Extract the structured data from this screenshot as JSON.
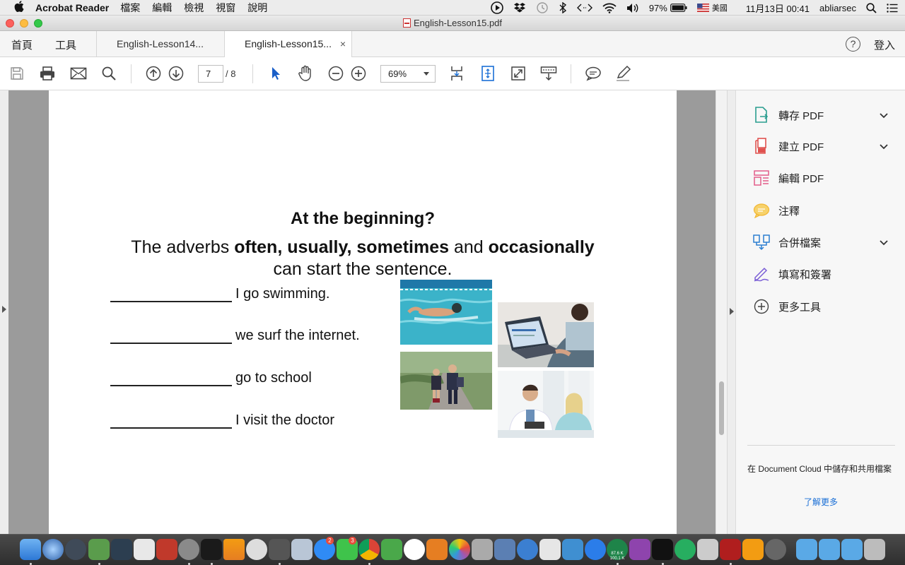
{
  "menubar": {
    "app_name": "Acrobat Reader",
    "menus": [
      "檔案",
      "編輯",
      "檢視",
      "視窗",
      "說明"
    ],
    "battery": "97%",
    "input_source": "美國",
    "datetime": "11月13日  00:41",
    "user": "abliarsec"
  },
  "window": {
    "title": "English-Lesson15.pdf"
  },
  "tabbar": {
    "home": "首頁",
    "tools": "工具",
    "tabs": [
      {
        "label": "English-Lesson14...",
        "active": false
      },
      {
        "label": "English-Lesson15...",
        "active": true
      }
    ],
    "close_glyph": "×",
    "help_glyph": "?",
    "login": "登入"
  },
  "toolbar": {
    "current_page": "7",
    "page_total": "/ 8",
    "zoom": "69%"
  },
  "document": {
    "heading": "At the beginning?",
    "sentence_parts": {
      "p1": "The adverbs ",
      "b1": "often, usually, sometimes",
      "p2": " and ",
      "b2": "occasionally",
      "p3": "can start the sentence."
    },
    "exercises": [
      "I go swimming.",
      "we surf the internet.",
      "go to school",
      "I visit the doctor"
    ],
    "photos": [
      "swimmer-photo",
      "laptop-photo",
      "children-walking-photo",
      "doctor-photo"
    ]
  },
  "sidebar": {
    "tools": [
      {
        "label": "轉存 PDF",
        "icon": "export-pdf-icon",
        "color": "#2a9d8f",
        "expandable": true
      },
      {
        "label": "建立 PDF",
        "icon": "create-pdf-icon",
        "color": "#e0524f",
        "expandable": true
      },
      {
        "label": "編輯 PDF",
        "icon": "edit-pdf-icon",
        "color": "#e35d8a",
        "expandable": false
      },
      {
        "label": "注釋",
        "icon": "comment-icon",
        "color": "#f2b632",
        "expandable": false
      },
      {
        "label": "合併檔案",
        "icon": "combine-files-icon",
        "color": "#2c7fd1",
        "expandable": true
      },
      {
        "label": "填寫和簽署",
        "icon": "fill-sign-icon",
        "color": "#7b5fd6",
        "expandable": false
      },
      {
        "label": "更多工具",
        "icon": "more-tools-icon",
        "color": "#444444",
        "expandable": false
      }
    ],
    "cloud_text": "在 Document Cloud 中儲存和共用檔案",
    "learn_more": "了解更多"
  },
  "dock": {
    "badges": {
      "app_store": "2",
      "facetime": "3"
    },
    "net_up": "87.6 K",
    "net_down": "100.1 K"
  }
}
